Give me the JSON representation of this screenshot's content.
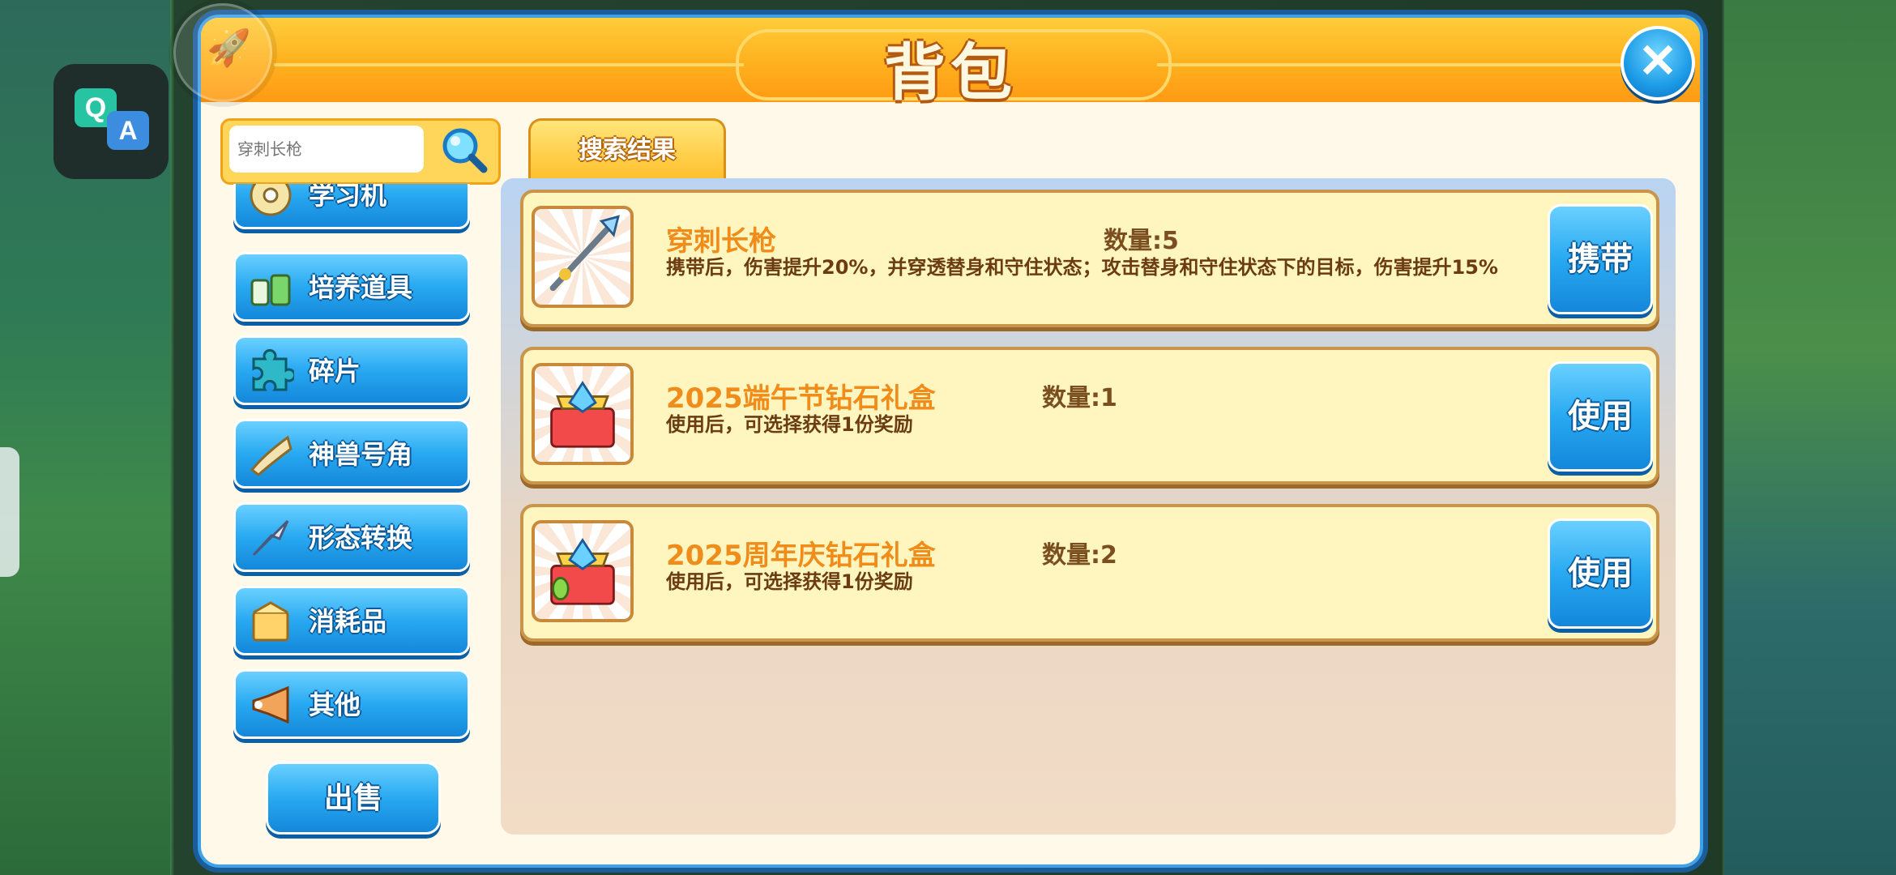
{
  "floating": {
    "qa_q": "Q",
    "qa_a": "A",
    "ball_icon": "rocket-icon"
  },
  "header": {
    "title": "背包",
    "close_icon": "close-icon",
    "close_glyph": "✕"
  },
  "search": {
    "value": "",
    "placeholder": "穿刺长枪"
  },
  "categories": [
    {
      "label": "学习机",
      "icon": "disc-icon"
    },
    {
      "label": "培养道具",
      "icon": "potion-icon"
    },
    {
      "label": "碎片",
      "icon": "puzzle-icon"
    },
    {
      "label": "神兽号角",
      "icon": "horn-icon"
    },
    {
      "label": "形态转换",
      "icon": "arrow-icon"
    },
    {
      "label": "消耗品",
      "icon": "box-icon"
    },
    {
      "label": "其他",
      "icon": "trumpet-icon"
    }
  ],
  "sell_label": "出售",
  "active_tab": "搜索结果",
  "items": [
    {
      "name": "穿刺长枪",
      "qty": "数量:5",
      "desc": "携带后，伤害提升20%，并穿透替身和守住状态；攻击替身和守住状态下的目标，伤害提升15%",
      "action": "携带",
      "icon": "spear-icon"
    },
    {
      "name": "2025端午节钻石礼盒",
      "qty": "数量:1",
      "desc": "使用后，可选择获得1份奖励",
      "action": "使用",
      "icon": "gift-box-icon"
    },
    {
      "name": "2025周年庆钻石礼盒",
      "qty": "数量:2",
      "desc": "使用后，可选择获得1份奖励",
      "action": "使用",
      "icon": "gift-box-icon"
    }
  ],
  "colors": {
    "accent_blue": "#28a9f1",
    "header_orange": "#ffb01e",
    "item_name": "#f08c1a"
  }
}
